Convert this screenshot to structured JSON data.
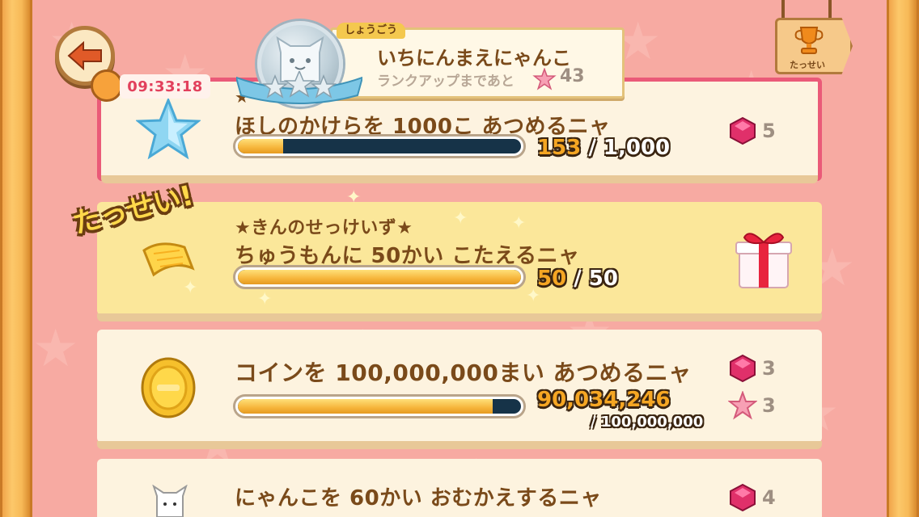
{
  "header": {
    "timer": "09:33:18",
    "rank_tag": "しょうごう",
    "rank_name": "いちにんまえにゃんこ",
    "rank_next_label": "ランクアップまであと",
    "rank_next_count": "43",
    "trophy_label": "たっせい"
  },
  "achievements": [
    {
      "title_line1": "★",
      "title": "ほしのかけらを 1000こ あつめるニャ",
      "current": "153",
      "total": "1,000",
      "progress": 0.153,
      "rewards": [
        {
          "icon": "ruby-gem-icon",
          "count": "5"
        }
      ]
    },
    {
      "stamp": "たっせい!",
      "title_line1": "★きんのせっけいず★",
      "title": "ちゅうもんに 50かい こたえるニャ",
      "current": "50",
      "total": "50",
      "progress": 1.0
    },
    {
      "title": "コインを 100,000,000まい あつめるニャ",
      "current": "90,034,246",
      "total": "100,000,000",
      "progress": 0.9003,
      "rewards": [
        {
          "icon": "ruby-gem-icon",
          "count": "3"
        },
        {
          "icon": "pink-star-icon",
          "count": "3"
        }
      ]
    },
    {
      "title": "にゃんこを 60かい おむかえするニャ",
      "rewards": [
        {
          "icon": "ruby-gem-icon",
          "count": "4"
        }
      ]
    }
  ],
  "colors": {
    "background": "#f7aaa2",
    "active_border": "#ea5a78",
    "completed_card": "#fbe79a",
    "progress_fill": "#f6b53a",
    "progress_track": "#163348"
  }
}
